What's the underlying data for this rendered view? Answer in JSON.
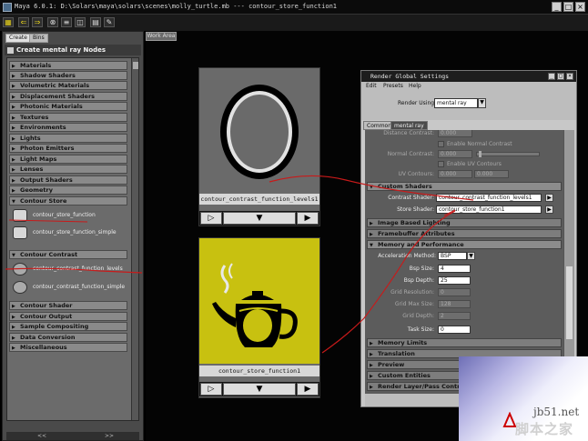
{
  "window": {
    "title": "Maya 6.0.1: D:\\Solars\\maya\\solars\\scenes\\molly_turtle.mb  ---  contour_store_function1",
    "buttons": [
      "_",
      "□",
      "×"
    ]
  },
  "left_panel": {
    "tabs": [
      "Create",
      "Bins"
    ],
    "header": "Create mental ray Nodes",
    "categories_top": [
      "Materials",
      "Shadow Shaders",
      "Volumetric Materials",
      "Displacement Shaders",
      "Photonic Materials",
      "Textures",
      "Environments",
      "Lights",
      "Photon Emitters",
      "Light Maps",
      "Lenses",
      "Output Shaders",
      "Geometry"
    ],
    "contour_store": {
      "label": "Contour Store",
      "items": [
        "contour_store_function",
        "contour_store_function_simple"
      ]
    },
    "contour_contrast": {
      "label": "Contour Contrast",
      "items": [
        "contour_contrast_function_levels",
        "contour_contrast_function_simple"
      ]
    },
    "categories_bottom": [
      "Contour Shader",
      "Contour Output",
      "Sample Compositing",
      "Data Conversion",
      "Miscellaneous"
    ],
    "footer": [
      "<<",
      ">>"
    ]
  },
  "work_area": {
    "tab": "Work Area",
    "swatches": [
      {
        "name": "contour_contrast_function_levels1"
      },
      {
        "name": "contour_store_function1"
      }
    ],
    "controls": [
      "▷",
      "▼",
      "▶"
    ]
  },
  "render_settings": {
    "title": "Render Global Settings",
    "menu": [
      "Edit",
      "Presets",
      "Help"
    ],
    "render_using_label": "Render Using:",
    "render_using_value": "mental ray",
    "tabs": [
      "Common",
      "mental ray"
    ],
    "fields": {
      "distance_contrast_label": "Distance Contrast:",
      "distance_contrast_value": "0.000",
      "enable_normal_contrast": "Enable Normal Contrast",
      "normal_contrast_label": "Normal Contrast:",
      "normal_contrast_value": "0.000",
      "enable_uv_contours": "Enable UV Contours",
      "uv_contours_label": "UV Contours:",
      "uv_contours_value1": "0.000",
      "uv_contours_value2": "0.000",
      "custom_shaders": "Custom Shaders",
      "contrast_shader_label": "Contrast Shader:",
      "contrast_shader_value": "contour_contrast_function_levels1",
      "store_shader_label": "Store Shader:",
      "store_shader_value": "contour_store_function1",
      "image_based_lighting": "Image Based Lighting",
      "framebuffer_attributes": "Framebuffer Attributes",
      "memory_and_performance": "Memory and Performance",
      "acceleration_method_label": "Acceleration Method:",
      "acceleration_method_value": "BSP",
      "bsp_size_label": "Bsp Size:",
      "bsp_size_value": "4",
      "bsp_depth_label": "Bsp Depth:",
      "bsp_depth_value": "25",
      "grid_resolution_label": "Grid Resolution:",
      "grid_resolution_value": "0",
      "grid_max_size_label": "Grid Max Size:",
      "grid_max_size_value": "128",
      "grid_depth_label": "Grid Depth:",
      "grid_depth_value": "2",
      "task_size_label": "Task Size:",
      "task_size_value": "0",
      "memory_limits": "Memory Limits",
      "translation": "Translation",
      "preview": "Preview",
      "custom_entities": "Custom Entities",
      "render_layer_pass_control": "Render Layer/Pass Control"
    }
  },
  "watermark": {
    "site": "jb51.net",
    "cn": "脚本之家"
  },
  "colors": {
    "teapot_bg": "#c8c110",
    "contour_annotation": "#c81a1a"
  }
}
